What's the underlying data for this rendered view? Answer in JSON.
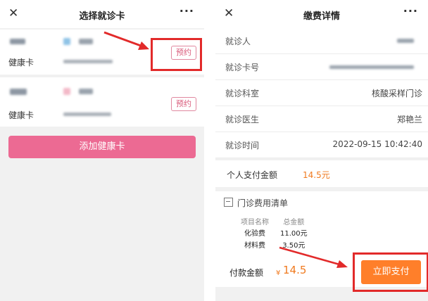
{
  "left": {
    "title": "选择就诊卡",
    "close_icon": "close-icon",
    "more_icon": "more-icon",
    "more_label": "···",
    "cards": [
      {
        "label": "健康卡",
        "book_label": "预约"
      },
      {
        "label": "健康卡",
        "book_label": "预约"
      }
    ],
    "add_button": "添加健康卡"
  },
  "right": {
    "title": "缴费详情",
    "more_label": "···",
    "details": [
      {
        "key": "就诊人",
        "value": ""
      },
      {
        "key": "就诊卡号",
        "value": ""
      },
      {
        "key": "就诊科室",
        "value": "核酸采样门诊"
      },
      {
        "key": "就诊医生",
        "value": "郑艳兰"
      },
      {
        "key": "就诊时间",
        "value": "2022-09-15 10:42:40"
      }
    ],
    "personal_amount_label": "个人支付金额",
    "personal_amount_value": "14.5元",
    "bill_title": "门诊费用清单",
    "bill_headers": [
      "项目名称",
      "总金额"
    ],
    "bill_items": [
      {
        "name": "化验费",
        "amount": "11.00元"
      },
      {
        "name": "材料费",
        "amount": "3.50元"
      }
    ],
    "pay_label": "付款金额",
    "pay_currency": "¥",
    "pay_amount": "14.5",
    "pay_button": "立即支付"
  },
  "colors": {
    "accent_pink": "#ec6a93",
    "accent_orange": "#ff7f2a",
    "annotation_red": "#e22a2a"
  }
}
